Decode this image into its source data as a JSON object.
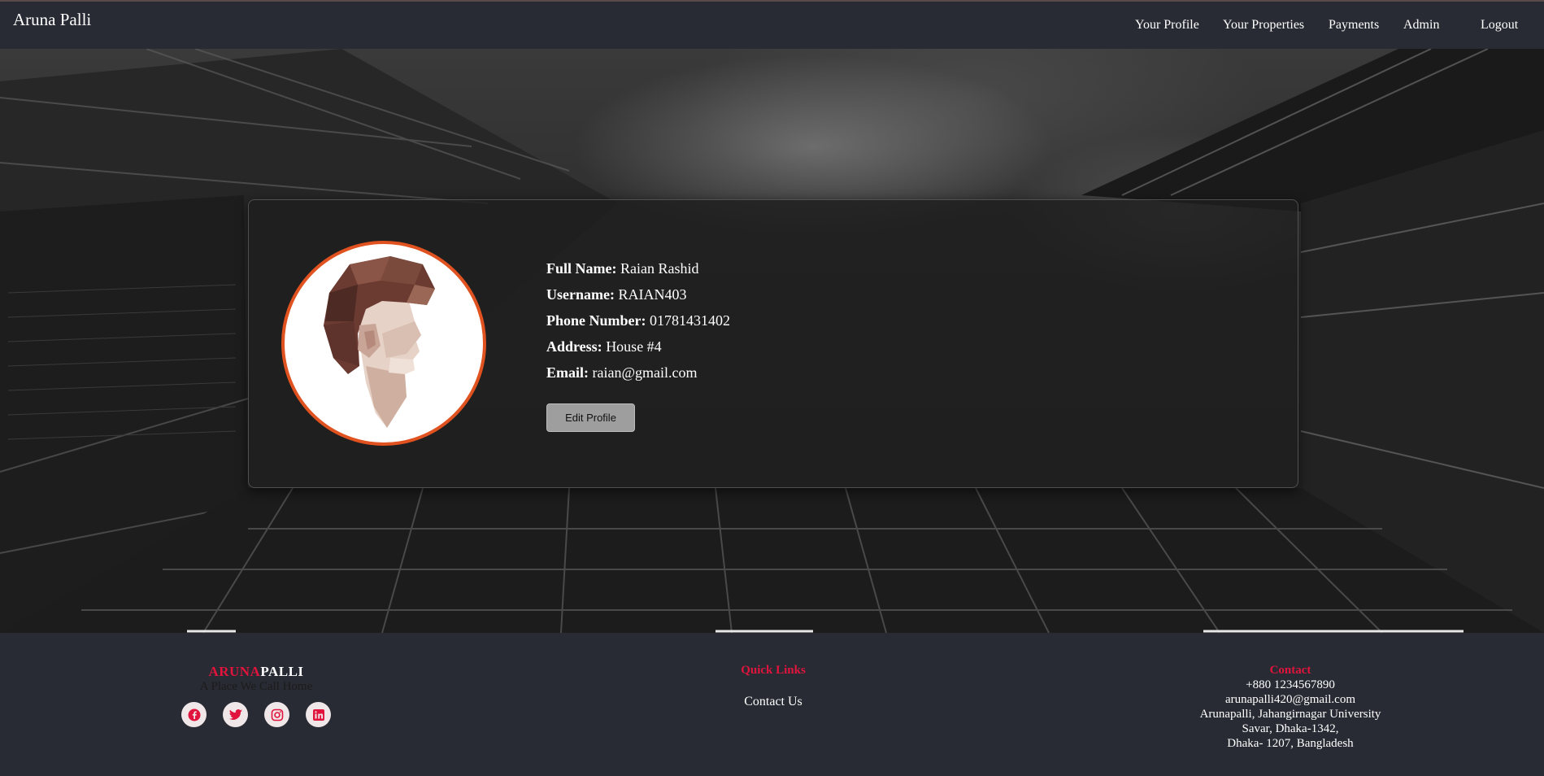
{
  "navbar": {
    "brand": "Aruna Palli",
    "links": [
      "Your Profile",
      "Your Properties",
      "Payments",
      "Admin",
      "Logout"
    ]
  },
  "profile": {
    "fields": [
      {
        "label": "Full Name:",
        "value": "Raian Rashid"
      },
      {
        "label": "Username:",
        "value": "RAIAN403"
      },
      {
        "label": "Phone Number:",
        "value": "01781431402"
      },
      {
        "label": "Address:",
        "value": "House #4"
      },
      {
        "label": "Email:",
        "value": "raian@gmail.com"
      }
    ],
    "edit_button": "Edit Profile"
  },
  "footer": {
    "brand_part1": "ARUNA",
    "brand_part2": "PALLI",
    "tagline": "A Place We Call Home",
    "socials": [
      "facebook-icon",
      "twitter-icon",
      "instagram-icon",
      "linkedin-icon"
    ],
    "quick_links_heading": "Quick Links",
    "quick_links": [
      "Contact Us"
    ],
    "contact_heading": "Contact",
    "contact_lines": [
      "+880 1234567890",
      "arunapalli420@gmail.com",
      "Arunapalli, Jahangirnagar University",
      "Savar, Dhaka-1342,",
      "Dhaka- 1207, Bangladesh"
    ]
  },
  "colors": {
    "navbar_bg": "#282b33",
    "accent_red": "#e0143c",
    "avatar_border": "#e0521f"
  }
}
